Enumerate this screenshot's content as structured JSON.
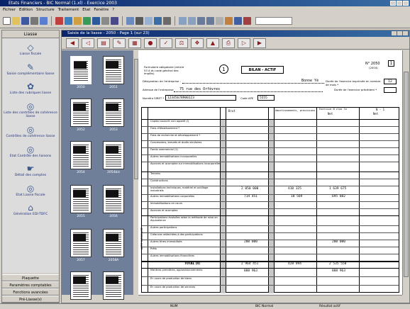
{
  "app": {
    "title": "Etats Financiers - BIC Normal (1.xl) - Exercice 2003"
  },
  "menu": [
    "Fichier",
    "Edition",
    "Structure",
    "Traitement",
    "Etat",
    "Fenêtre",
    "?"
  ],
  "left_panel": {
    "header": "Liasse",
    "items": [
      {
        "label": "Liasse fiscale",
        "icon": "diamond-icon"
      },
      {
        "label": "Saisie complémentaire liasse",
        "icon": "pen-icon"
      },
      {
        "label": "Liste des rubriques liasse",
        "icon": "flower-icon"
      },
      {
        "label": "Liste des contrôles de cohérence liasse",
        "icon": "lens-icon"
      },
      {
        "label": "Contrôles de cohérence liasse",
        "icon": "lens-icon"
      },
      {
        "label": "Etat Contrôle des liaisons",
        "icon": "lens-icon"
      },
      {
        "label": "Détail des comptes",
        "icon": "hand-icon"
      },
      {
        "label": "Etat Liasse fiscale",
        "icon": "lens-icon"
      },
      {
        "label": "Génération EDI-TDFC",
        "icon": "bank-icon"
      }
    ],
    "bottom_buttons": [
      "Plaquette",
      "Paramètres comptables",
      "Fonctions avancées",
      "Pré-Liasse(s)"
    ]
  },
  "main_window": {
    "title": "Saisie de la liasse - 2050 - Page 1 (sur 23)"
  },
  "thumbnails": [
    {
      "label": "2050",
      "selected": true
    },
    {
      "label": "2051"
    },
    {
      "label": "2052"
    },
    {
      "label": "2053"
    },
    {
      "label": "2054"
    },
    {
      "label": "2054bis"
    },
    {
      "label": "2055"
    },
    {
      "label": "2056"
    },
    {
      "label": "2057"
    },
    {
      "label": "2058A"
    },
    {
      "label": ""
    },
    {
      "label": ""
    }
  ],
  "form": {
    "circle_number": "1",
    "title": "BILAN - ACTIF",
    "form_code": "N° 2050",
    "form_code_sub": "(2004)",
    "form_code_box": "1",
    "header_note": "Formulaire obligatoire (article 53 A du code général des impôts)",
    "company_label": "Désignation de l'entreprise :",
    "company_value": "Bonne Yé",
    "duration_label": "Durée de l'exercice exprimée en nombre de mois *",
    "duration_value": "12",
    "address_label": "Adresse de l'entreprise",
    "address_value": "75 rue des Orfèvres",
    "prev_duration_label": "Durée de l'exercice précédent *",
    "siret_label": "Numéro SIRET *",
    "siret_value": "12345678900123",
    "naf_label": "Code APE",
    "naf_value": "5555",
    "col_headers": [
      "Brut",
      "Amortissements, provisions",
      "Net",
      "Net"
    ],
    "col_sub_headers": [
      "1",
      "2",
      "3",
      "4"
    ],
    "exercise_n": "Exercice N clos le",
    "exercise_n1": "N - 1",
    "row_labels": [
      "Capital souscrit non appelé (I)",
      "Frais d'établissement *",
      "Frais de recherche et développement *",
      "Concessions, brevets et droits similaires",
      "Fonds commercial (1)",
      "Autres immobilisations incorporelles",
      "Avances et acomptes sur immobilisations incorporelles",
      "Terrains",
      "Constructions",
      "Installations techniques, matériel et outillage industriels",
      "Autres immobilisations corporelles",
      "Immobilisations en cours",
      "Avances et acomptes",
      "Participations évaluées selon la méthode de mise en équivalence",
      "Autres participations",
      "Créances rattachées à des participations",
      "Autres titres immobilisés",
      "Prêts",
      "Autres immobilisations financières",
      "TOTAL (II)",
      "Matières premières, approvisionnements",
      "En cours de production de biens",
      "En cours de production de services"
    ],
    "values": {
      "installations_brut": "2 050 000",
      "installations_amort": "410 325",
      "installations_net": "1 639 675",
      "autres_corp_brut": "714 451",
      "autres_corp_amort": "18 569",
      "autres_corp_net": "695 882",
      "autres_titres_brut": "200 000",
      "autres_titres_net": "200 000",
      "total_brut": "2 964 451",
      "total_amort": "428 894",
      "total_net": "2 535 558",
      "matieres_brut": "888 963",
      "matieres_net": "888 963"
    },
    "side_label": "ACTIF IMMOBILISÉ"
  },
  "statusbar": {
    "left": "NUM",
    "middle": "BIC Normal",
    "right": "Résultat actif"
  },
  "colors": {
    "titlebar_start": "#0a246a",
    "titlebar_end": "#3a6ea5",
    "thumb_panel_bg": "#6f7f9a",
    "chrome": "#d4d0c8"
  }
}
